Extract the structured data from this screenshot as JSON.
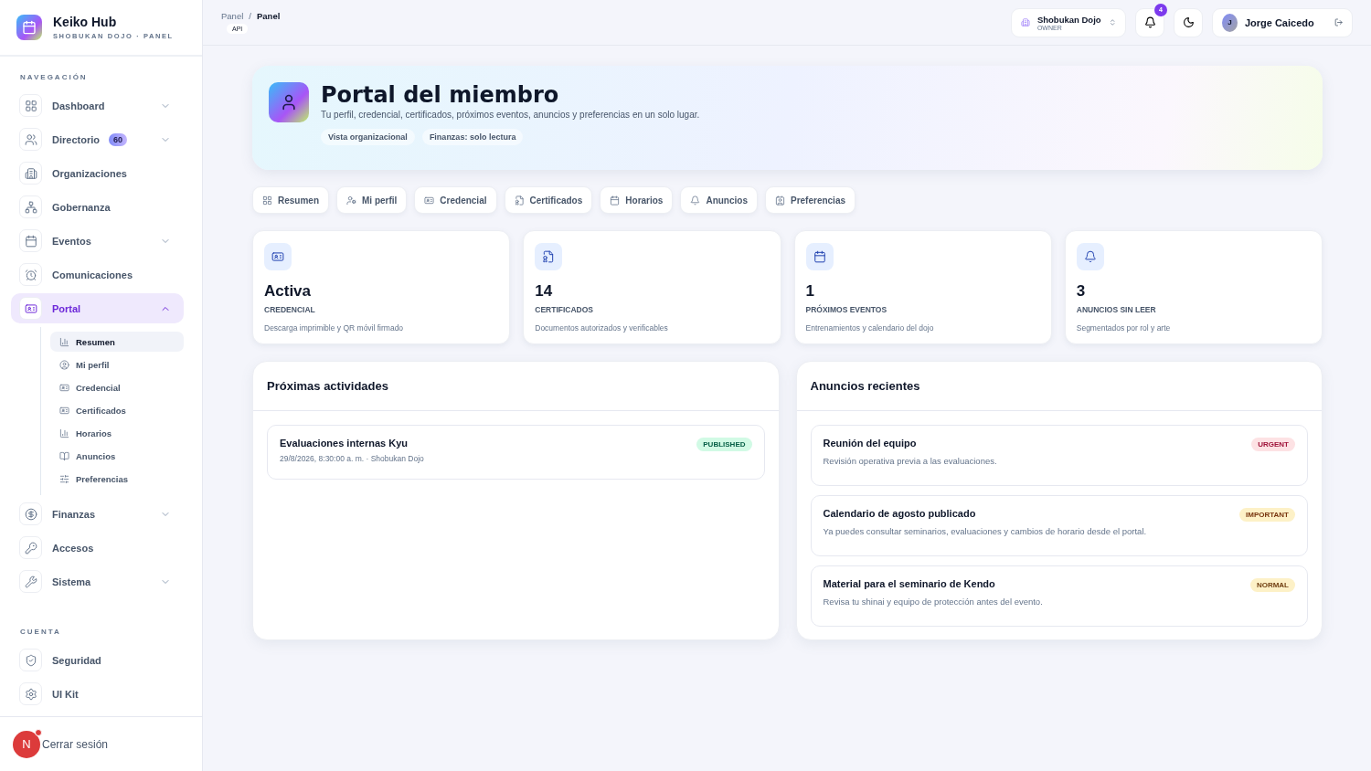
{
  "brand": {
    "name": "Keiko Hub",
    "subtitle": "SHOBUKAN DOJO · PANEL"
  },
  "sidebar": {
    "sections": [
      {
        "heading": "NAVEGACIÓN",
        "items": [
          {
            "label": "Dashboard",
            "expanded": false,
            "selected": false
          },
          {
            "label": "Directorio",
            "badge": "60",
            "expanded": false,
            "selected": false
          },
          {
            "label": "Organizaciones",
            "selected": false
          },
          {
            "label": "Gobernanza",
            "selected": false
          },
          {
            "label": "Eventos",
            "expanded": false,
            "selected": false
          },
          {
            "label": "Comunicaciones",
            "selected": false
          },
          {
            "label": "Portal",
            "expanded": true,
            "selected": true,
            "children": [
              {
                "label": "Resumen",
                "selected": true
              },
              {
                "label": "Mi perfil",
                "selected": false
              },
              {
                "label": "Credencial",
                "selected": false
              },
              {
                "label": "Certificados",
                "selected": false
              },
              {
                "label": "Horarios",
                "selected": false
              },
              {
                "label": "Anuncios",
                "selected": false
              },
              {
                "label": "Preferencias",
                "selected": false
              }
            ]
          },
          {
            "label": "Finanzas",
            "expanded": false,
            "selected": false
          },
          {
            "label": "Accesos",
            "selected": false
          },
          {
            "label": "Sistema",
            "expanded": false,
            "selected": false
          }
        ]
      },
      {
        "heading": "CUENTA",
        "items": [
          {
            "label": "Seguridad",
            "selected": false
          },
          {
            "label": "UI Kit",
            "selected": false
          }
        ]
      }
    ]
  },
  "logout": {
    "avatar": "N",
    "label": "Cerrar sesión"
  },
  "breadcrumb": {
    "items": [
      "Panel",
      "Panel"
    ],
    "separator": "/"
  },
  "api_tag": "API",
  "org_switcher": {
    "name": "Shobukan Dojo",
    "role": "OWNER"
  },
  "notifications": {
    "count": "4"
  },
  "user": {
    "initial": "J",
    "name": "Jorge Caicedo"
  },
  "hero": {
    "title": "Portal del miembro",
    "subtitle": "Tu perfil, credencial, certificados, próximos eventos, anuncios y preferencias en un solo lugar.",
    "tags": [
      "Vista organizacional",
      "Finanzas: solo lectura"
    ]
  },
  "tabs": [
    "Resumen",
    "Mi perfil",
    "Credencial",
    "Certificados",
    "Horarios",
    "Anuncios",
    "Preferencias"
  ],
  "stats": [
    {
      "value": "Activa",
      "label": "CREDENCIAL",
      "note": "Descarga imprimible y QR móvil firmado"
    },
    {
      "value": "14",
      "label": "CERTIFICADOS",
      "note": "Documentos autorizados y verificables"
    },
    {
      "value": "1",
      "label": "PRÓXIMOS EVENTOS",
      "note": "Entrenamientos y calendario del dojo"
    },
    {
      "value": "3",
      "label": "ANUNCIOS SIN LEER",
      "note": "Segmentados por rol y arte"
    }
  ],
  "activities": {
    "title": "Próximas actividades",
    "items": [
      {
        "title": "Evaluaciones internas Kyu",
        "meta": "29/8/2026, 8:30:00 a. m. · Shobukan Dojo",
        "status": "PUBLISHED"
      }
    ]
  },
  "announcements": {
    "title": "Anuncios recientes",
    "items": [
      {
        "title": "Reunión del equipo",
        "body": "Revisión operativa previa a las evaluaciones.",
        "priority": "URGENT",
        "kind": "urgent"
      },
      {
        "title": "Calendario de agosto publicado",
        "body": "Ya puedes consultar seminarios, evaluaciones y cambios de horario desde el portal.",
        "priority": "IMPORTANT",
        "kind": "important"
      },
      {
        "title": "Material para el seminario de Kendo",
        "body": "Revisa tu shinai y equipo de protección antes del evento.",
        "priority": "NORMAL",
        "kind": "normal"
      }
    ]
  }
}
